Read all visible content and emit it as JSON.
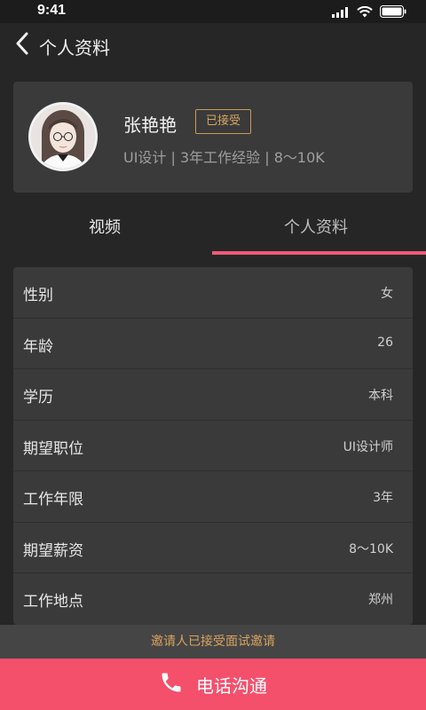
{
  "status_bar": {
    "time": "9:41"
  },
  "nav": {
    "title": "个人资料"
  },
  "profile": {
    "name": "张艳艳",
    "status_badge": "已接受",
    "meta": "UI设计 | 3年工作经验 | 8～10K"
  },
  "tabs": [
    {
      "label": "视频",
      "active": false
    },
    {
      "label": "个人资料",
      "active": true
    }
  ],
  "info_rows": [
    {
      "label": "性别",
      "value": "女"
    },
    {
      "label": "年龄",
      "value": "26"
    },
    {
      "label": "学历",
      "value": "本科"
    },
    {
      "label": "期望职位",
      "value": "UI设计师"
    },
    {
      "label": "工作年限",
      "value": "3年"
    },
    {
      "label": "期望薪资",
      "value": "8～10K"
    },
    {
      "label": "工作地点",
      "value": "郑州"
    }
  ],
  "notice": "邀请人已接受面试邀请",
  "call_button": {
    "label": "电话沟通",
    "icon": "phone-icon"
  },
  "colors": {
    "accent": "#f4506c",
    "badge": "#d8a55e",
    "background": "#262626",
    "card": "#3a3a3a"
  }
}
